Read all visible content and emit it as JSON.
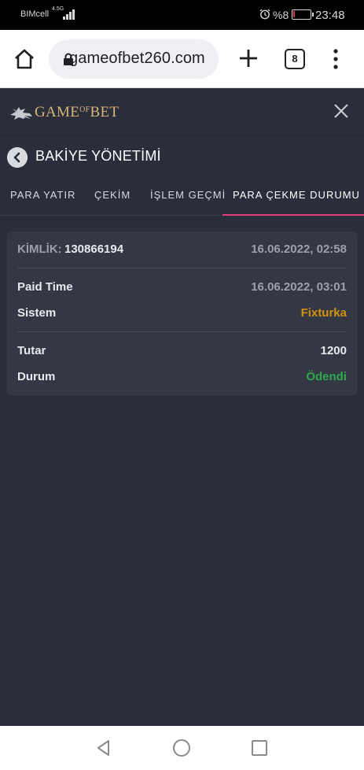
{
  "status_bar": {
    "carrier": "BIMcell",
    "network": "4.5G",
    "battery_percent": "%8",
    "battery_level": 0.08,
    "time": "23:48",
    "battery_color": "#e53935"
  },
  "browser": {
    "url": "gameofbet260.com",
    "tab_count": "8",
    "icons": [
      "home-icon",
      "lock-icon",
      "plus-icon",
      "tabs-icon",
      "more-vert-icon"
    ]
  },
  "app": {
    "logo_text_left": "GAME",
    "logo_text_mid": "OF",
    "logo_text_right": "BET",
    "close_icon": "close-icon"
  },
  "page": {
    "title": "BAKİYE YÖNETİMİ",
    "back_icon": "chevron-left-icon"
  },
  "tabs": [
    {
      "label": "PARA YATIR",
      "active": false
    },
    {
      "label": "ÇEKİM",
      "active": false
    },
    {
      "label": "İŞLEM GEÇMİ",
      "active": false
    },
    {
      "label": "PARA ÇEKME DURUMU",
      "active": true
    }
  ],
  "accent_color": "#e0407a",
  "withdrawal": {
    "id_label": "KİMLİK:",
    "id_value": "130866194",
    "created_at": "16.06.2022, 02:58",
    "paid_time_label": "Paid Time",
    "paid_time_value": "16.06.2022, 03:01",
    "system_label": "Sistem",
    "system_value": "Fixturka",
    "system_color": "#d4930f",
    "amount_label": "Tutar",
    "amount_value": "1200",
    "status_label": "Durum",
    "status_value": "Ödendi",
    "status_color": "#2fa84f"
  }
}
